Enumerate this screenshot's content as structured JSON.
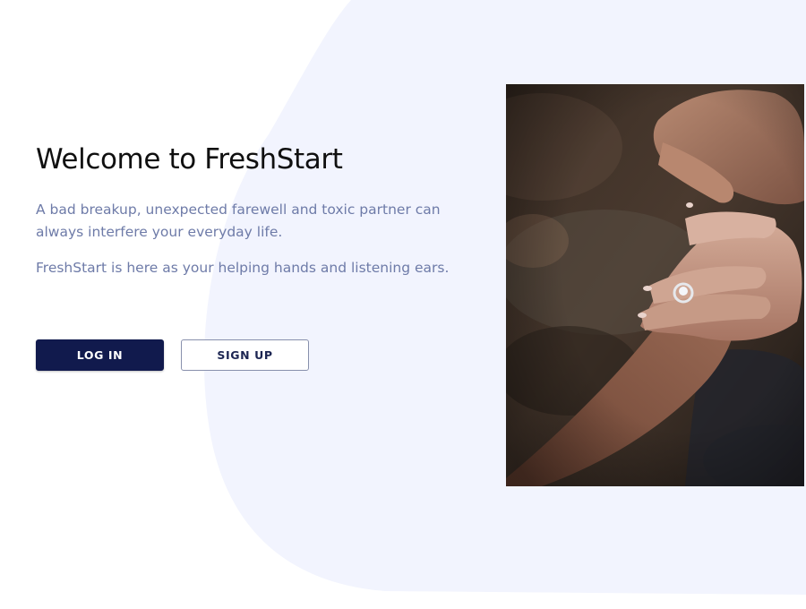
{
  "hero": {
    "title": "Welcome to FreshStart",
    "paragraph_1": "A bad breakup, unexpected farewell and toxic partner can always interfere your everyday life.",
    "paragraph_2": "FreshStart is here as your helping hands and listening ears."
  },
  "actions": {
    "login_label": "LOG IN",
    "signup_label": "SIGN UP"
  },
  "colors": {
    "background": "#ffffff",
    "blob": "#f2f4fe",
    "title": "#101010",
    "body_text": "#6e7ba8",
    "primary_button": "#111a4d",
    "secondary_button_border": "#8890ac"
  },
  "image": {
    "subject": "photo of clasped hands with engagement ring"
  }
}
